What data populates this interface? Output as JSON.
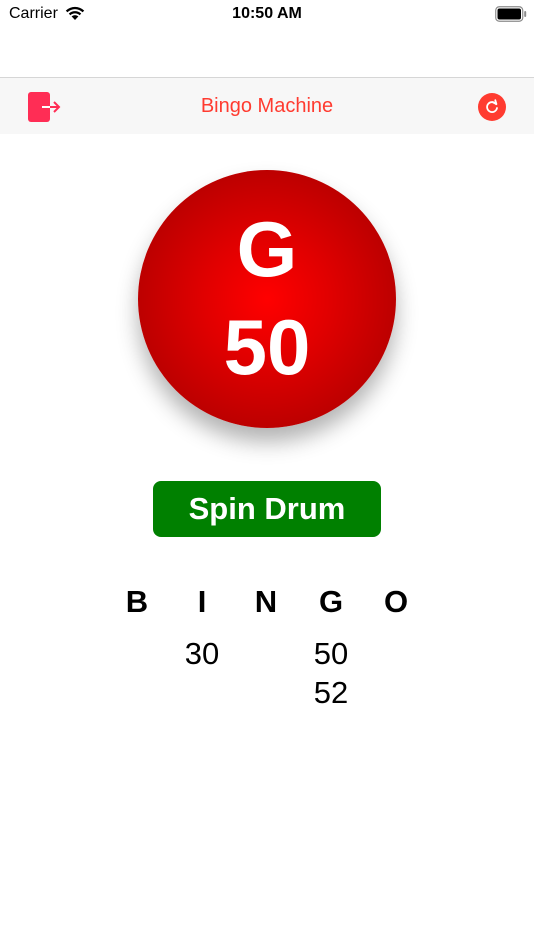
{
  "status_bar": {
    "carrier": "Carrier",
    "time": "10:50 AM",
    "wifi_icon": "wifi-icon",
    "battery_icon": "battery-icon"
  },
  "nav_bar": {
    "title": "Bingo Machine",
    "left_icon": "logout-icon",
    "right_icon": "reset-icon"
  },
  "current_ball": {
    "letter": "G",
    "number": "50",
    "color": "#e00000"
  },
  "spin_button": {
    "label": "Spin Drum",
    "color": "#008000"
  },
  "board": {
    "columns": [
      {
        "letter": "B",
        "numbers": []
      },
      {
        "letter": "I",
        "numbers": [
          "30"
        ]
      },
      {
        "letter": "N",
        "numbers": []
      },
      {
        "letter": "G",
        "numbers": [
          "50",
          "52"
        ]
      },
      {
        "letter": "O",
        "numbers": []
      }
    ]
  },
  "colors": {
    "accent": "#ff3b30",
    "logout": "#ff2d55"
  }
}
